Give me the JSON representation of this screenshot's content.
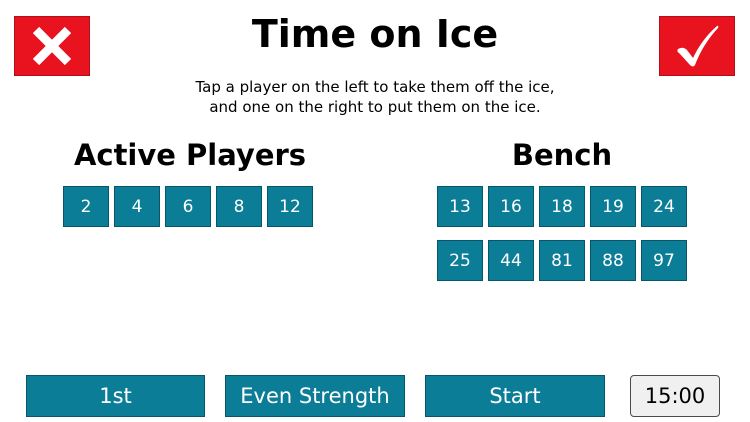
{
  "header": {
    "title": "Time on Ice",
    "instructions_line1": "Tap a player on the left to take them off the ice,",
    "instructions_line2": "and one on the right to put them on the ice.",
    "cancel_icon": "close-x-icon",
    "confirm_icon": "checkmark-icon"
  },
  "active": {
    "heading": "Active Players",
    "players": [
      "2",
      "4",
      "6",
      "8",
      "12"
    ]
  },
  "bench": {
    "heading": "Bench",
    "players": [
      "13",
      "16",
      "18",
      "19",
      "24",
      "25",
      "44",
      "81",
      "88",
      "97"
    ]
  },
  "controls": {
    "period": "1st",
    "strength": "Even Strength",
    "start": "Start",
    "clock": "15:00"
  },
  "colors": {
    "accent_red": "#e9121f",
    "player_button": "#0b7d96",
    "clock_background": "#f0f0f0"
  }
}
